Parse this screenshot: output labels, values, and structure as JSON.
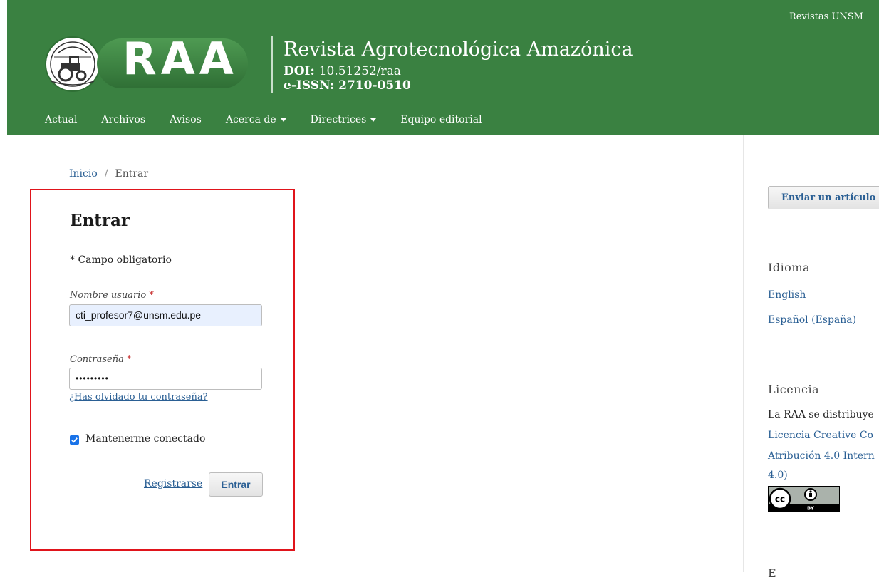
{
  "header": {
    "top_link": "Revistas UNSM",
    "logo_text": "RAA",
    "journal_title": "Revista Agrotecnológica Amazónica",
    "doi_label": "DOI:",
    "doi_value": "10.51252/raa",
    "issn_label": "e-ISSN:",
    "issn_value": "2710-0510",
    "brand_color": "#3a8141"
  },
  "nav": {
    "items": [
      {
        "label": "Actual"
      },
      {
        "label": "Archivos"
      },
      {
        "label": "Avisos"
      },
      {
        "label": "Acerca de",
        "dropdown": true
      },
      {
        "label": "Directrices",
        "dropdown": true
      },
      {
        "label": "Equipo editorial"
      }
    ]
  },
  "breadcrumb": {
    "home": "Inicio",
    "separator": "/",
    "current": "Entrar"
  },
  "login": {
    "heading": "Entrar",
    "required_note": "* Campo obligatorio",
    "username_label": "Nombre usuario",
    "username_value": "cti_profesor7@unsm.edu.pe",
    "password_label": "Contraseña",
    "password_value": "•••••••••",
    "required_marker": "*",
    "forgot_link": "¿Has olvidado tu contraseña?",
    "remember_label": "Mantenerme conectado",
    "remember_checked": true,
    "register_link": "Registrarse",
    "submit_label": "Entrar",
    "highlight_color": "#e0141b"
  },
  "sidebar": {
    "submit_button": "Enviar un artículo",
    "language_heading": "Idioma",
    "languages": [
      "English",
      "Español (España)"
    ],
    "license_heading": "Licencia",
    "license_text_1": "La RAA se distribuye",
    "license_link_1": "Licencia Creative Co",
    "license_link_2": "Atribución 4.0 Intern",
    "license_link_3": "4.0)",
    "cc_badge_text": "BY",
    "cut_heading": "E"
  }
}
